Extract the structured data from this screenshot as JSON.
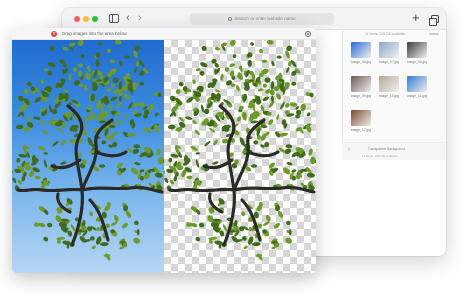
{
  "browser": {
    "address_placeholder": "Search or enter website name",
    "icons": [
      "sidebar-icon",
      "chevron-left-icon",
      "chevron-right-icon",
      "plus-icon",
      "tabs-icon"
    ]
  },
  "files_panel": {
    "header": "11 items, 225 GB available",
    "items": [
      {
        "label": "image_06.jpg",
        "color": "#2b6ad8"
      },
      {
        "label": "image_07.jpg",
        "color": "#8aa7c4"
      },
      {
        "label": "image_08.jpg",
        "color": "#3c3c40"
      },
      {
        "label": "image_09.jpg",
        "color": "#6b5a55"
      },
      {
        "label": "image_10.jpg",
        "color": "#b9a996"
      },
      {
        "label": "image_11.jpg",
        "color": "#2f7bd8"
      },
      {
        "label": "image_12.jpg",
        "color": "#7a4a2e"
      }
    ],
    "status": "Transparent Background",
    "footer": "11 items, 225 GB available"
  },
  "app": {
    "drop_hint": "Drag images into the area below",
    "icons": [
      "close-icon",
      "gear-icon"
    ],
    "colors": {
      "leaf": "#6e9a2a",
      "leaf_dark": "#3f6b1a",
      "branch": "#2a2a26"
    }
  }
}
